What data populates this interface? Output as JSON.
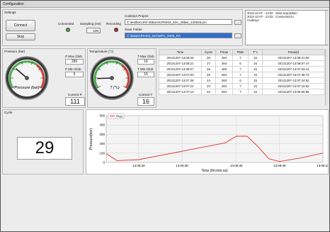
{
  "window": {
    "title": "Configuration"
  },
  "settings": {
    "label": "Settings",
    "connect_label": "Connect",
    "stop_label": "Stop",
    "connected_label": "Connected",
    "sampling_label": "Sampling (ms)",
    "sampling_value": "100",
    "recording_label": "Recording",
    "codesys_project_label": "Codesys Project",
    "codesys_project_value": "C:\\testbench\\0-30Bars\\CR0403_53A_30Bar_130526.pro",
    "save_folder_label": "Save Folder",
    "save_folder_value": "C:\\Data\\CR0403_53A\\MPC_5000_RA",
    "browse_label": "..."
  },
  "log": {
    "lines": [
      "2013-12-07 - 13:02 : Start acquisition",
      "2013-12-07 - 13:02 : Connected to",
      "Codesys"
    ]
  },
  "pressure": {
    "label": "Pressure (bar)",
    "gauge_label": "Pressure (bar)",
    "max_label": "P Max Glob",
    "max_value": "289",
    "min_label": "P Min Glob",
    "min_value": "6",
    "current_label": "Current P",
    "current_value": "111",
    "gauge_min": 0,
    "gauge_max": 350,
    "gauge_value": 111
  },
  "temperature": {
    "label": "Temperature (°c)",
    "gauge_label": "T (°c)",
    "max_label": "T Max Glob",
    "max_value": "16",
    "min_label": "T Min Glob",
    "min_value": "15",
    "current_label": "Current T",
    "current_value": "16",
    "gauge_min": 0,
    "gauge_max": 100,
    "gauge_value": 16
  },
  "table": {
    "columns": [
      "Time",
      "Cycle",
      "Pmax",
      "PMin",
      "T°c",
      "Pmax(t)"
    ],
    "rows": [
      [
        "20131207-13:08:26",
        "28",
        "284",
        "7",
        "16",
        "20131207-13:08:21:50"
      ],
      [
        "20131207-13:08:21",
        "27",
        "284",
        "6",
        "16",
        "20131207-13:08:07:47"
      ],
      [
        "20131207-13:08:07",
        "26",
        "283",
        "7",
        "16",
        "20131207-13:07:53:14"
      ],
      [
        "20131207-13:07:53",
        "25",
        "284",
        "7",
        "15",
        "20131207-13:07:38:73"
      ],
      [
        "20131207-13:07:38",
        "24",
        "283",
        "6",
        "15",
        "20131207-13:07:24:52"
      ],
      [
        "20131207-13:07:24",
        "23",
        "284",
        "7",
        "15",
        "20131207-13:07:10:52"
      ],
      [
        "20131207-13:07:10",
        "22",
        "284",
        "7",
        "16",
        "20131207-13:06:55:96"
      ]
    ]
  },
  "cycle": {
    "label": "Cycle",
    "value": "29"
  },
  "chart": {
    "legend": "Pres",
    "ylabel": "Pressure(bar)",
    "xlabel": "Time (hh:mm:ss)",
    "yticks": [
      "0",
      "100",
      "200",
      "300",
      "400",
      "500"
    ],
    "xticks": [
      "13:08:26",
      "13:08:30",
      "13:08:35",
      "13:08:39",
      "13:08:43"
    ],
    "line_color": "#e03030"
  },
  "chart_data": {
    "type": "line",
    "x": [
      "13:08:23",
      "13:08:24",
      "13:08:26",
      "13:08:28",
      "13:08:30",
      "13:08:32",
      "13:08:34",
      "13:08:35",
      "13:08:36",
      "13:08:37",
      "13:08:38",
      "13:08:39",
      "13:08:41",
      "13:08:43"
    ],
    "series": [
      {
        "name": "Pres",
        "values": [
          95,
          20,
          30,
          75,
          120,
          165,
          210,
          280,
          280,
          170,
          40,
          10,
          50,
          100
        ]
      }
    ],
    "xlabel": "Time (hh:mm:ss)",
    "ylabel": "Pressure(bar)",
    "ylim": [
      0,
      500
    ],
    "grid": true,
    "legend": "top-left"
  }
}
